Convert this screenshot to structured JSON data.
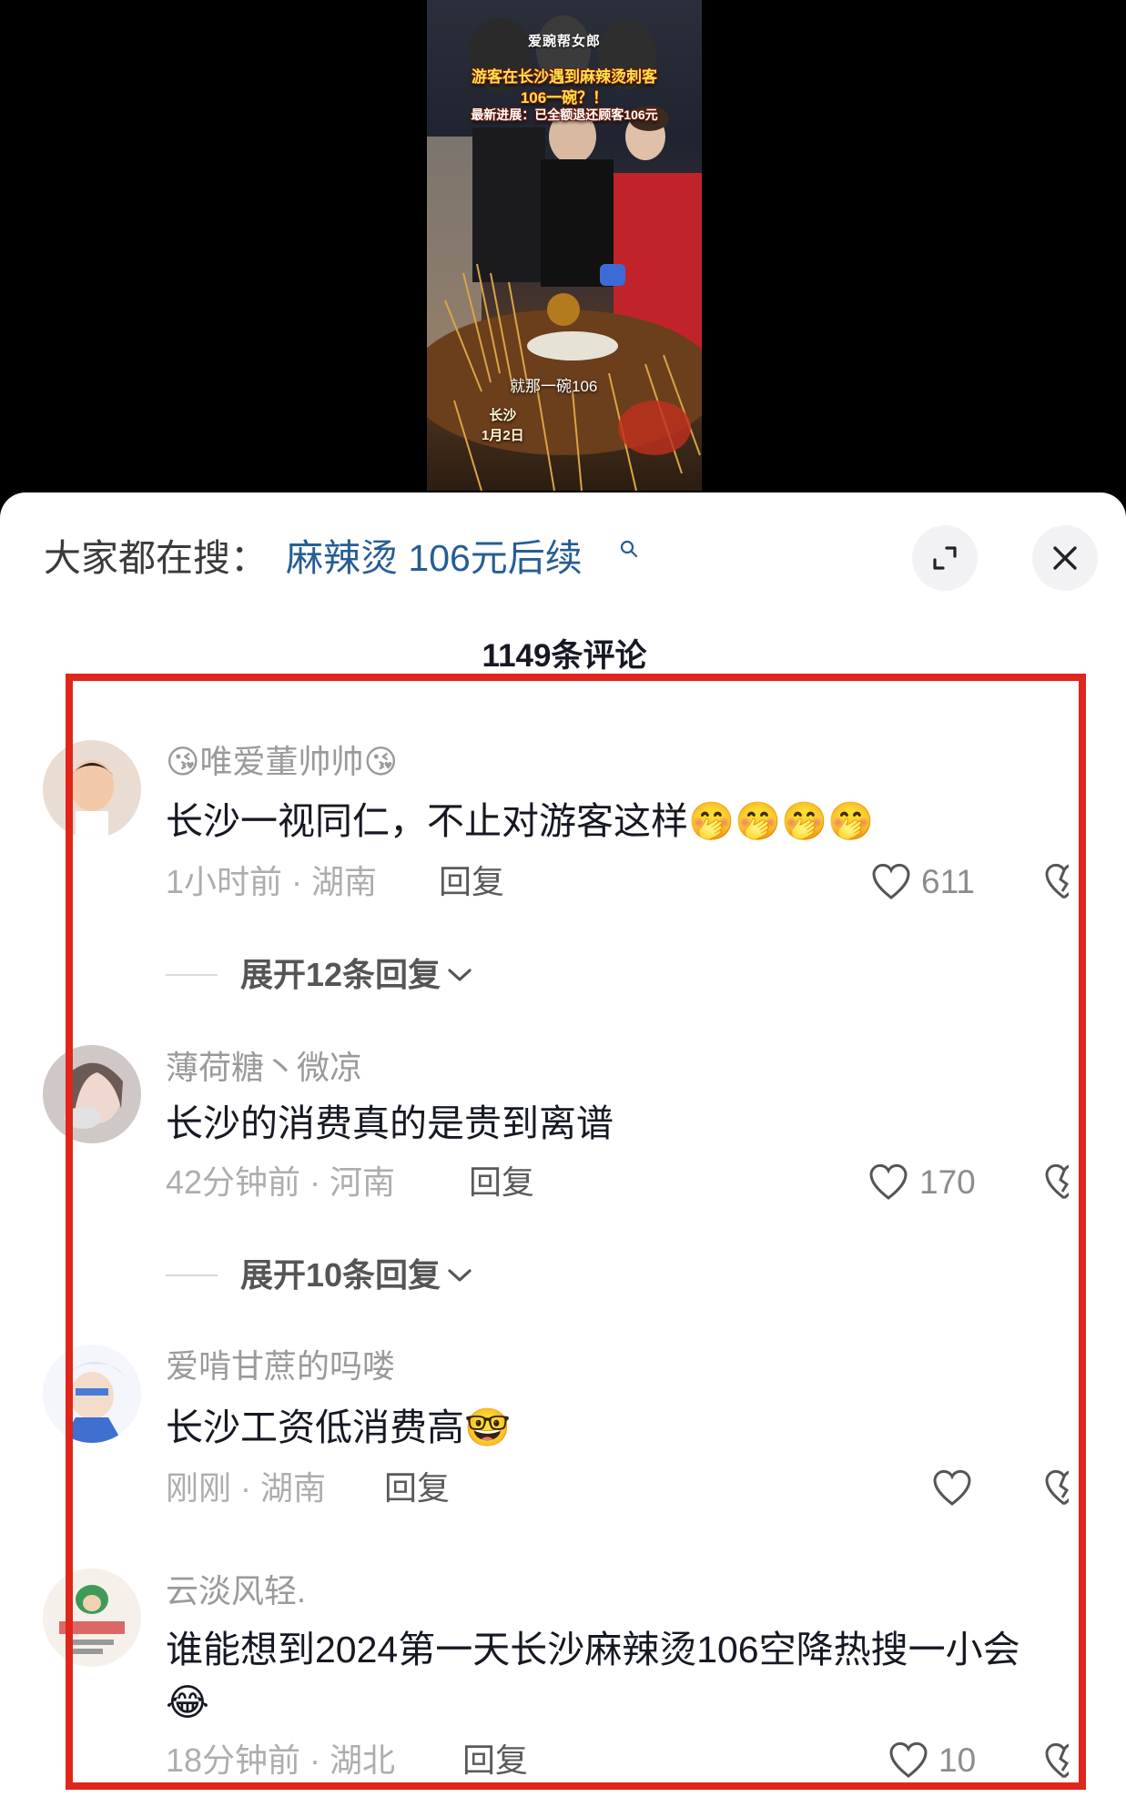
{
  "video": {
    "logo": "爱豌帮女郎",
    "headline": "游客在长沙遇到麻辣烫刺客",
    "headline2": "106一碗？！",
    "update": "最新进展：已全额退还顾客106元",
    "caption": "就那一碗106",
    "location": "长沙",
    "date": "1月2日"
  },
  "search": {
    "prefix": "大家都在搜：",
    "query": "麻辣烫 106元后续",
    "icon": "search-icon"
  },
  "header": {
    "count_label": "1149条评论",
    "expand_icon": "expand-icon",
    "close_icon": "close-icon"
  },
  "comments": [
    {
      "username": "😘唯爱董帅帅😘",
      "text": "长沙一视同仁，不止对游客这样🤭🤭🤭🤭",
      "meta": "1小时前 · 湖南",
      "reply": "回复",
      "likes": "611",
      "expand": "展开12条回复"
    },
    {
      "username": "薄荷糖丶微凉",
      "text": "长沙的消费真的是贵到离谱",
      "meta": "42分钟前 · 河南",
      "reply": "回复",
      "likes": "170",
      "expand": "展开10条回复"
    },
    {
      "username": "爱啃甘蔗的吗喽",
      "text": "长沙工资低消费高🤓",
      "meta": "刚刚 · 湖南",
      "reply": "回复",
      "likes": ""
    },
    {
      "username": "云淡风轻.",
      "text": "谁能想到2024第一天长沙麻辣烫106空降热搜一小会😂",
      "meta": "18分钟前 · 湖北",
      "reply": "回复",
      "likes": "10"
    }
  ],
  "colors": {
    "search_link": "#265d94",
    "highlight_border": "#e0261a",
    "sheet_bg": "#ffffff"
  }
}
